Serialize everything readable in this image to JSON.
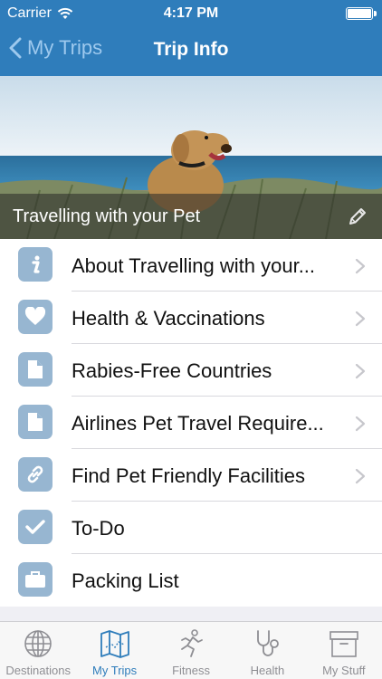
{
  "status_bar": {
    "carrier": "Carrier",
    "time": "4:17 PM"
  },
  "nav": {
    "back_label": "My Trips",
    "title": "Trip Info"
  },
  "hero": {
    "title": "Travelling with your Pet"
  },
  "list": {
    "items": [
      {
        "label": "About Travelling with your...",
        "icon": "info-icon",
        "has_chevron": true
      },
      {
        "label": "Health & Vaccinations",
        "icon": "heart-icon",
        "has_chevron": true
      },
      {
        "label": "Rabies-Free Countries",
        "icon": "document-icon",
        "has_chevron": true
      },
      {
        "label": "Airlines Pet Travel Require...",
        "icon": "document-icon",
        "has_chevron": true
      },
      {
        "label": "Find Pet Friendly Facilities",
        "icon": "link-icon",
        "has_chevron": true
      },
      {
        "label": "To-Do",
        "icon": "checkmark-icon",
        "has_chevron": false
      },
      {
        "label": "Packing List",
        "icon": "suitcase-icon",
        "has_chevron": false
      }
    ]
  },
  "tabbar": {
    "tabs": [
      {
        "label": "Destinations",
        "icon": "globe-icon",
        "active": false
      },
      {
        "label": "My Trips",
        "icon": "map-icon",
        "active": true
      },
      {
        "label": "Fitness",
        "icon": "runner-icon",
        "active": false
      },
      {
        "label": "Health",
        "icon": "stethoscope-icon",
        "active": false
      },
      {
        "label": "My Stuff",
        "icon": "archive-box-icon",
        "active": false
      }
    ]
  },
  "colors": {
    "nav_blue": "#2f7dbb",
    "icon_tile": "#97b6d1",
    "back_text": "#9ec9ee",
    "tab_inactive": "#8e8e93"
  }
}
